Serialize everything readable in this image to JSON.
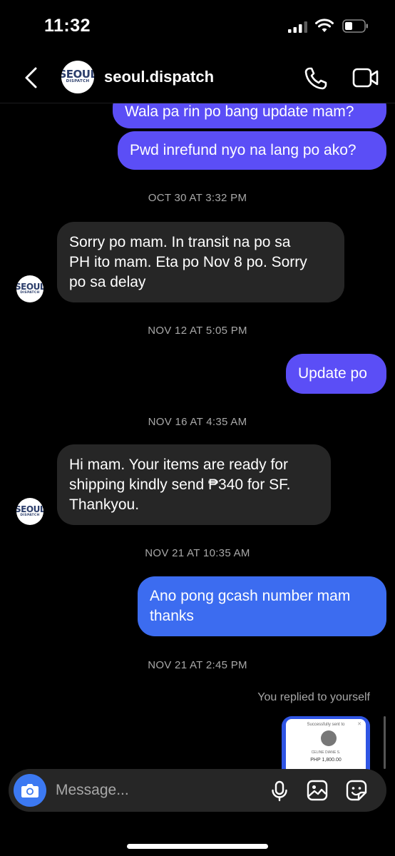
{
  "status_bar": {
    "time": "11:32"
  },
  "header": {
    "name": "seoul.dispatch",
    "avatar_logo_main": "SEOUL",
    "avatar_logo_sub": "DISPATCH"
  },
  "messages": [
    {
      "type": "out",
      "text": "Wala pa rin po bang update mam?"
    },
    {
      "type": "out",
      "text": "Pwd inrefund nyo na lang po ako?"
    },
    {
      "type": "time",
      "text": "OCT 30 AT 3:32 PM"
    },
    {
      "type": "in",
      "lines": [
        "Sorry po mam. In transit na po sa",
        "PH ito mam. Eta po Nov 8 po. Sorry",
        "po sa delay"
      ]
    },
    {
      "type": "time",
      "text": "NOV 12 AT 5:05 PM"
    },
    {
      "type": "out",
      "text": "Update po"
    },
    {
      "type": "time",
      "text": "NOV 16 AT 4:35 AM"
    },
    {
      "type": "in",
      "lines": [
        "Hi mam. Your items are ready for",
        "shipping kindly send ₱340 for SF.",
        "Thankyou."
      ]
    },
    {
      "type": "time",
      "text": "NOV 21 AT 10:35 AM"
    },
    {
      "type": "out",
      "lines": [
        "Ano pong gcash number mam",
        "thanks"
      ]
    },
    {
      "type": "time",
      "text": "NOV 21 AT 2:45 PM"
    }
  ],
  "reply_note": "You replied to yourself",
  "shared_image": {
    "title": "Successfully sent to",
    "name": "CELINE DIANE S.",
    "amount": "PHP 1,800.00"
  },
  "composer": {
    "placeholder": "Message..."
  },
  "colors": {
    "outgoing_bubble": "#5b4ef6",
    "outgoing_bubble_blue": "#3c6cf0",
    "incoming_bubble": "#262626",
    "camera_button": "#3c79f2"
  }
}
